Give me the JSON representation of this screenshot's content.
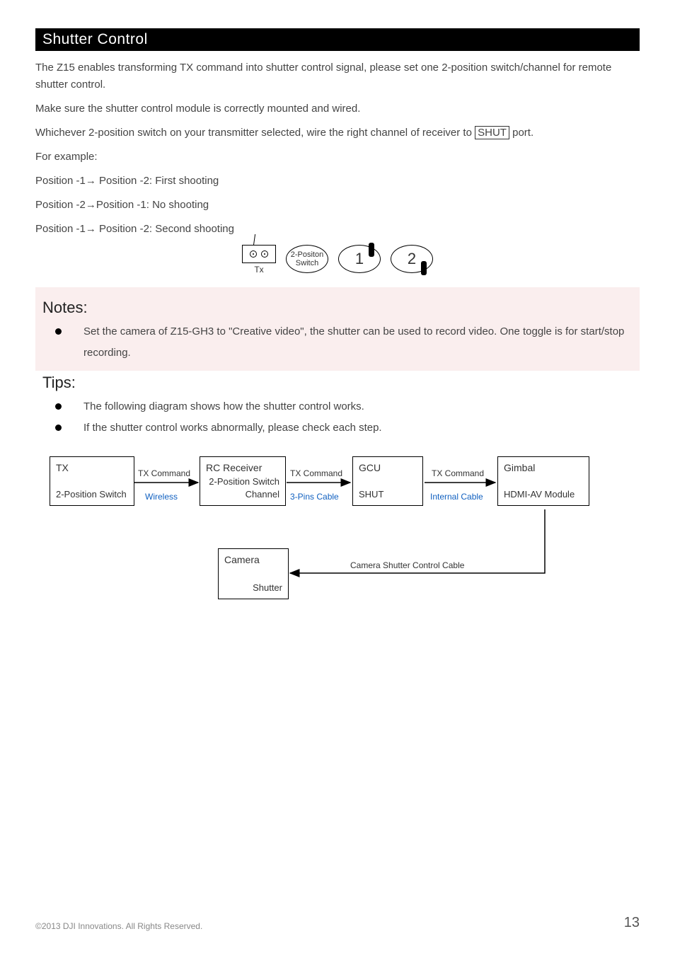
{
  "section_title": "Shutter Control",
  "p1": "The Z15 enables transforming TX command into shutter control signal, please set one 2-position switch/channel for remote shutter control.",
  "p2": "Make sure the shutter control module is correctly mounted and wired.",
  "p3_a": "Whichever 2-position switch on your transmitter selected, wire the right channel of receiver to ",
  "p3_box": "SHUT",
  "p3_b": " port.",
  "p4": "For example:",
  "p5": "Position -1→ Position -2: First shooting",
  "p6": "Position -2→Position -1: No shooting",
  "p7": "Position -1→ Position -2: Second shooting",
  "tx_label": "Tx",
  "switch_label": "2-Positon Switch",
  "pos1": "1",
  "pos2": "2",
  "notes_header": "Notes:",
  "notes_bullet": "Set the camera of Z15-GH3 to \"Creative video\", the shutter can be used to record video. One toggle is for start/stop recording.",
  "tips_header": "Tips:",
  "tips_b1": "The following diagram shows how the shutter control works.",
  "tips_b2": "If the shutter control works abnormally, please check each step.",
  "flow": {
    "tx": {
      "title": "TX",
      "sub": "2-Position Switch"
    },
    "rc": {
      "title": "RC Receiver",
      "sub": "2-Position Switch Channel"
    },
    "gcu": {
      "title": "GCU",
      "sub": "SHUT"
    },
    "gimbal": {
      "title": "Gimbal",
      "sub": "HDMI-AV Module"
    },
    "camera": {
      "title": "Camera",
      "sub": "Shutter"
    },
    "l_txcmd": "TX Command",
    "l_wireless": "Wireless",
    "l_3pin": "3-Pins Cable",
    "l_internal": "Internal Cable",
    "l_camcable": "Camera Shutter Control Cable"
  },
  "footer_copy": "©2013 DJI Innovations. All Rights Reserved.",
  "page_num": "13"
}
